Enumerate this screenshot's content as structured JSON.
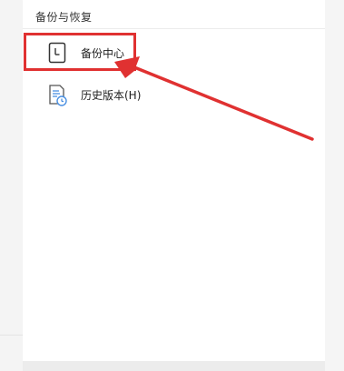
{
  "panel": {
    "section_title": "备份与恢复",
    "items": [
      {
        "label": "备份中心",
        "icon": "document-clock-icon"
      },
      {
        "label": "历史版本(H)",
        "icon": "document-history-icon"
      }
    ]
  },
  "annotation": {
    "color": "#e03131"
  }
}
